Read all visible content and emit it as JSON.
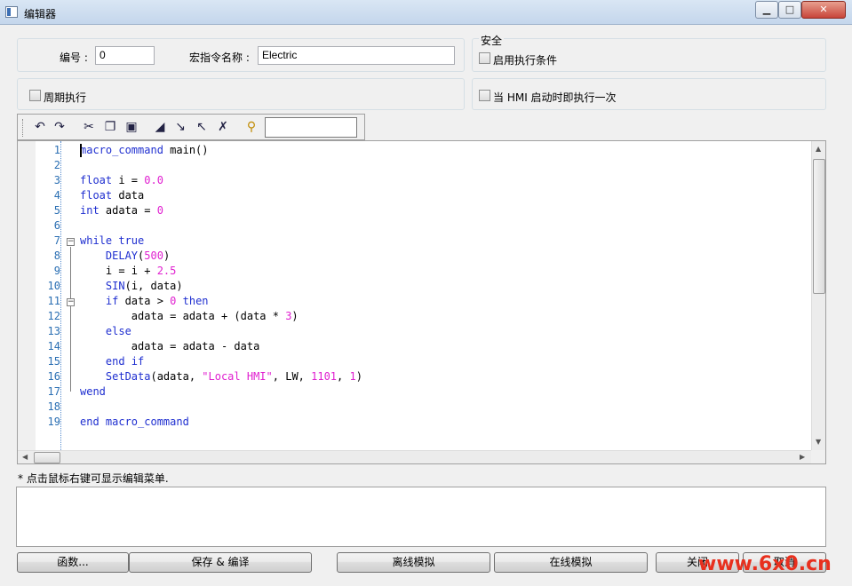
{
  "window": {
    "title": "编辑器",
    "minimize": "▁",
    "maximize": "□",
    "close": "✕"
  },
  "top": {
    "id_label": "编号 :",
    "id_value": "0",
    "name_label": "宏指令名称 :",
    "name_value": "Electric",
    "security_label": "安全",
    "enable_condition": "启用执行条件",
    "periodic": "周期执行",
    "on_hmi_start": "当 HMI 启动时即执行一次"
  },
  "toolbar": {
    "icons": [
      "undo-icon",
      "redo-icon",
      "cut-icon",
      "copy-icon",
      "paste-icon",
      "set-bookmark-icon",
      "next-bookmark-icon",
      "prev-bookmark-icon",
      "clear-bookmarks-icon",
      "find-icon"
    ],
    "search_value": ""
  },
  "editor": {
    "line_numbers": [
      "1",
      "2",
      "3",
      "4",
      "5",
      "6",
      "7",
      "8",
      "9",
      "10",
      "11",
      "12",
      "13",
      "14",
      "15",
      "16",
      "17",
      "18",
      "19"
    ],
    "lines": [
      [
        {
          "t": "kw",
          "v": "macro_command"
        },
        {
          "t": "",
          "v": " main()"
        }
      ],
      [],
      [
        {
          "t": "kw",
          "v": "float"
        },
        {
          "t": "",
          "v": " i = "
        },
        {
          "t": "num",
          "v": "0.0"
        }
      ],
      [
        {
          "t": "kw",
          "v": "float"
        },
        {
          "t": "",
          "v": " data"
        }
      ],
      [
        {
          "t": "kw",
          "v": "int"
        },
        {
          "t": "",
          "v": " adata = "
        },
        {
          "t": "num",
          "v": "0"
        }
      ],
      [],
      [
        {
          "t": "kw",
          "v": "while"
        },
        {
          "t": "",
          "v": " "
        },
        {
          "t": "kw",
          "v": "true"
        }
      ],
      [
        {
          "t": "",
          "v": "    "
        },
        {
          "t": "fn",
          "v": "DELAY"
        },
        {
          "t": "",
          "v": "("
        },
        {
          "t": "num",
          "v": "500"
        },
        {
          "t": "",
          "v": ")"
        }
      ],
      [
        {
          "t": "",
          "v": "    i = i + "
        },
        {
          "t": "num",
          "v": "2.5"
        }
      ],
      [
        {
          "t": "",
          "v": "    "
        },
        {
          "t": "fn",
          "v": "SIN"
        },
        {
          "t": "",
          "v": "(i, data)"
        }
      ],
      [
        {
          "t": "",
          "v": "    "
        },
        {
          "t": "kw",
          "v": "if"
        },
        {
          "t": "",
          "v": " data > "
        },
        {
          "t": "num",
          "v": "0"
        },
        {
          "t": "",
          "v": " "
        },
        {
          "t": "kw",
          "v": "then"
        }
      ],
      [
        {
          "t": "",
          "v": "        adata = adata + (data * "
        },
        {
          "t": "num",
          "v": "3"
        },
        {
          "t": "",
          "v": ")"
        }
      ],
      [
        {
          "t": "",
          "v": "    "
        },
        {
          "t": "kw",
          "v": "else"
        }
      ],
      [
        {
          "t": "",
          "v": "        adata = adata - data"
        }
      ],
      [
        {
          "t": "",
          "v": "    "
        },
        {
          "t": "kw",
          "v": "end if"
        }
      ],
      [
        {
          "t": "",
          "v": "    "
        },
        {
          "t": "fn",
          "v": "SetData"
        },
        {
          "t": "",
          "v": "(adata, "
        },
        {
          "t": "str",
          "v": "\"Local HMI\""
        },
        {
          "t": "",
          "v": ", LW, "
        },
        {
          "t": "num",
          "v": "1101"
        },
        {
          "t": "",
          "v": ", "
        },
        {
          "t": "num",
          "v": "1"
        },
        {
          "t": "",
          "v": ")"
        }
      ],
      [
        {
          "t": "kw",
          "v": "wend"
        }
      ],
      [],
      [
        {
          "t": "kw",
          "v": "end macro_command"
        }
      ]
    ],
    "fold_markers": [
      "⊟",
      "⊟"
    ]
  },
  "hint": "* 点击鼠标右键可显示编辑菜单.",
  "buttons": {
    "functions": "函数...",
    "save_compile": "保存 & 编译",
    "offline_sim": "离线模拟",
    "online_sim": "在线模拟",
    "close": "关闭",
    "cancel": "取消"
  },
  "watermark": "www.6x0.cn",
  "colors": {
    "keyword": "#1f2fd0",
    "number": "#e020d0",
    "line_number": "#2b6fb3",
    "titlebar": "#c4d6ec"
  }
}
